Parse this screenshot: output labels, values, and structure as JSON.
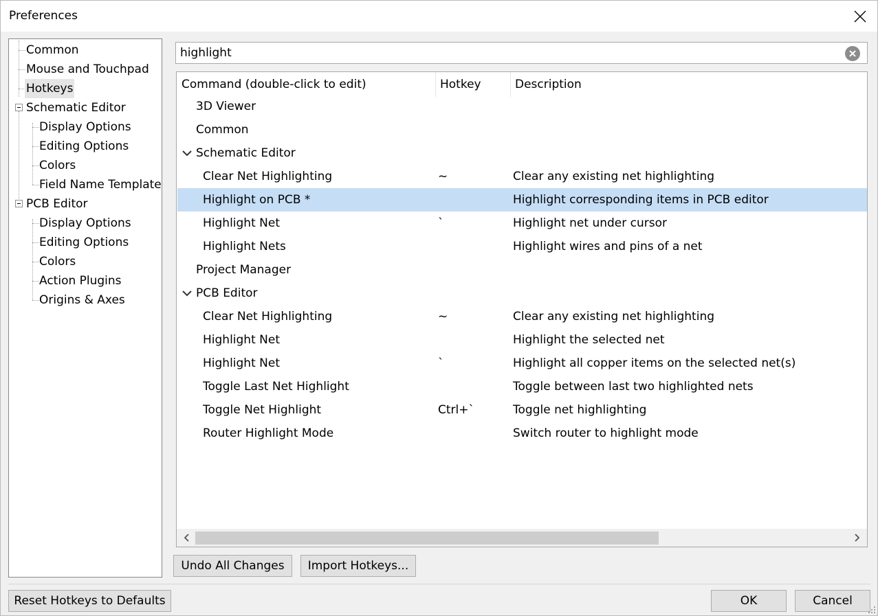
{
  "window": {
    "title": "Preferences"
  },
  "tree": {
    "items": [
      {
        "label": "Common"
      },
      {
        "label": "Mouse and Touchpad"
      },
      {
        "label": "Hotkeys"
      },
      {
        "label": "Schematic Editor"
      },
      {
        "label": "Display Options"
      },
      {
        "label": "Editing Options"
      },
      {
        "label": "Colors"
      },
      {
        "label": "Field Name Templates"
      },
      {
        "label": "PCB Editor"
      },
      {
        "label": "Display Options"
      },
      {
        "label": "Editing Options"
      },
      {
        "label": "Colors"
      },
      {
        "label": "Action Plugins"
      },
      {
        "label": "Origins & Axes"
      }
    ]
  },
  "search": {
    "value": "highlight"
  },
  "table": {
    "columns": [
      "Command (double-click to edit)",
      "Hotkey",
      "Description"
    ],
    "rows": [
      {
        "command": "3D Viewer",
        "hotkey": "",
        "description": ""
      },
      {
        "command": "Common",
        "hotkey": "",
        "description": ""
      },
      {
        "command": "Schematic Editor",
        "hotkey": "",
        "description": ""
      },
      {
        "command": "Clear Net Highlighting",
        "hotkey": "~",
        "description": "Clear any existing net highlighting"
      },
      {
        "command": "Highlight on PCB *",
        "hotkey": "",
        "description": "Highlight corresponding items in PCB editor"
      },
      {
        "command": "Highlight Net",
        "hotkey": "`",
        "description": "Highlight net under cursor"
      },
      {
        "command": "Highlight Nets",
        "hotkey": "",
        "description": "Highlight wires and pins of a net"
      },
      {
        "command": "Project Manager",
        "hotkey": "",
        "description": ""
      },
      {
        "command": "PCB Editor",
        "hotkey": "",
        "description": ""
      },
      {
        "command": "Clear Net Highlighting",
        "hotkey": "~",
        "description": "Clear any existing net highlighting"
      },
      {
        "command": "Highlight Net",
        "hotkey": "",
        "description": "Highlight the selected net"
      },
      {
        "command": "Highlight Net",
        "hotkey": "`",
        "description": "Highlight all copper items on the selected net(s)"
      },
      {
        "command": "Toggle Last Net Highlight",
        "hotkey": "",
        "description": "Toggle between last two highlighted nets"
      },
      {
        "command": "Toggle Net Highlight",
        "hotkey": "Ctrl+`",
        "description": "Toggle net highlighting"
      },
      {
        "command": "Router Highlight Mode",
        "hotkey": "",
        "description": "Switch router to highlight mode"
      }
    ]
  },
  "buttons": {
    "undo": "Undo All Changes",
    "import": "Import Hotkeys...",
    "reset": "Reset Hotkeys to Defaults",
    "ok": "OK",
    "cancel": "Cancel"
  },
  "colors": {
    "selection": "#c5def5",
    "background": "#f0f0f0"
  }
}
